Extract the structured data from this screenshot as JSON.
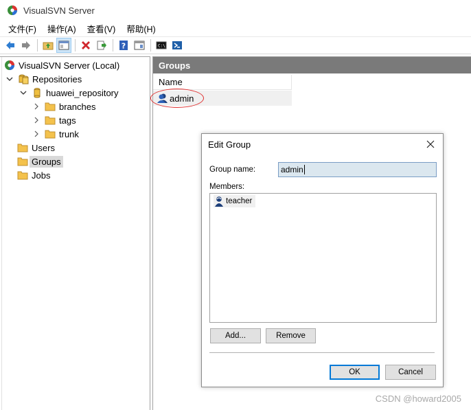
{
  "window": {
    "title": "VisualSVN Server",
    "app_icon": "visualsvn-logo-icon"
  },
  "menubar": {
    "items": [
      {
        "label": "文件(F)"
      },
      {
        "label": "操作(A)"
      },
      {
        "label": "查看(V)"
      },
      {
        "label": "帮助(H)"
      }
    ]
  },
  "toolbar": {
    "buttons": [
      "back-arrow-icon",
      "forward-arrow-icon",
      "up-folder-icon",
      "show-hide-tree-icon",
      "delete-icon",
      "export-icon",
      "help-icon",
      "properties-icon",
      "console-icon",
      "powershell-icon"
    ]
  },
  "tree": {
    "root": {
      "label": "VisualSVN Server (Local)"
    },
    "repositories": {
      "label": "Repositories"
    },
    "repo": {
      "label": "huawei_repository"
    },
    "branches": {
      "label": "branches"
    },
    "tags": {
      "label": "tags"
    },
    "trunk": {
      "label": "trunk"
    },
    "users": {
      "label": "Users"
    },
    "groups": {
      "label": "Groups"
    },
    "jobs": {
      "label": "Jobs"
    },
    "selected": "Groups"
  },
  "right_pane": {
    "header": "Groups",
    "column_name": "Name",
    "rows": [
      {
        "name": "admin"
      }
    ]
  },
  "dialog": {
    "title": "Edit Group",
    "group_name_label": "Group name:",
    "group_name_value": "admin",
    "members_label": "Members:",
    "members": [
      {
        "name": "teacher"
      }
    ],
    "add_label": "Add...",
    "remove_label": "Remove",
    "ok_label": "OK",
    "cancel_label": "Cancel"
  },
  "watermark": "CSDN @howard2005",
  "colors": {
    "pane_header_bg": "#7a7a7a",
    "selection_bg": "#d9d9d9",
    "annotation_red": "#e03030",
    "default_button_border": "#0078d7",
    "folder_yellow": "#f4c24c"
  }
}
